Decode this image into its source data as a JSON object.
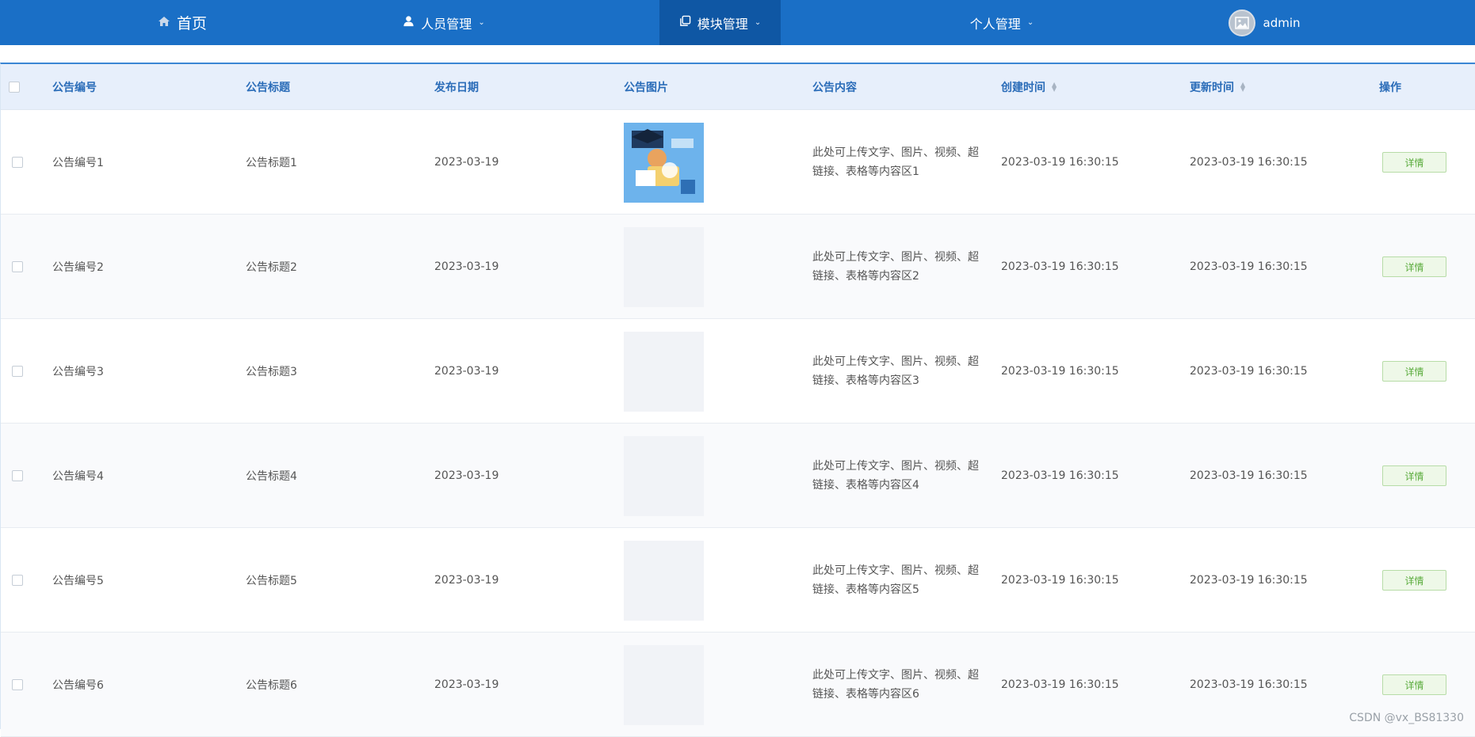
{
  "nav": {
    "home": "首页",
    "personnel": "人员管理",
    "modules": "模块管理",
    "personal": "个人管理",
    "user": "admin"
  },
  "table": {
    "headers": [
      "公告编号",
      "公告标题",
      "发布日期",
      "公告图片",
      "公告内容",
      "创建时间",
      "更新时间",
      "操作"
    ],
    "rows": [
      {
        "id": "公告编号1",
        "title": "公告标题1",
        "date": "2023-03-19",
        "content_line1": "此处可上传文字、图片、视频、超",
        "content_line2": "链接、表格等内容区1",
        "created": "2023-03-19 16:30:15",
        "updated": "2023-03-19 16:30:15",
        "action": "详情",
        "has_image": true
      },
      {
        "id": "公告编号2",
        "title": "公告标题2",
        "date": "2023-03-19",
        "content_line1": "此处可上传文字、图片、视频、超",
        "content_line2": "链接、表格等内容区2",
        "created": "2023-03-19 16:30:15",
        "updated": "2023-03-19 16:30:15",
        "action": "详情",
        "has_image": false
      },
      {
        "id": "公告编号3",
        "title": "公告标题3",
        "date": "2023-03-19",
        "content_line1": "此处可上传文字、图片、视频、超",
        "content_line2": "链接、表格等内容区3",
        "created": "2023-03-19 16:30:15",
        "updated": "2023-03-19 16:30:15",
        "action": "详情",
        "has_image": false
      },
      {
        "id": "公告编号4",
        "title": "公告标题4",
        "date": "2023-03-19",
        "content_line1": "此处可上传文字、图片、视频、超",
        "content_line2": "链接、表格等内容区4",
        "created": "2023-03-19 16:30:15",
        "updated": "2023-03-19 16:30:15",
        "action": "详情",
        "has_image": false
      },
      {
        "id": "公告编号5",
        "title": "公告标题5",
        "date": "2023-03-19",
        "content_line1": "此处可上传文字、图片、视频、超",
        "content_line2": "链接、表格等内容区5",
        "created": "2023-03-19 16:30:15",
        "updated": "2023-03-19 16:30:15",
        "action": "详情",
        "has_image": false
      },
      {
        "id": "公告编号6",
        "title": "公告标题6",
        "date": "2023-03-19",
        "content_line1": "此处可上传文字、图片、视频、超",
        "content_line2": "链接、表格等内容区6",
        "created": "2023-03-19 16:30:15",
        "updated": "2023-03-19 16:30:15",
        "action": "详情",
        "has_image": false
      }
    ]
  },
  "watermark": "CSDN @vx_BS81330",
  "colors": {
    "nav_bg": "#1a6fc6",
    "nav_active": "#0f57a4",
    "header_bg": "#e7effb",
    "header_text": "#2a6cb8",
    "detail_button": "#5aab3c"
  }
}
